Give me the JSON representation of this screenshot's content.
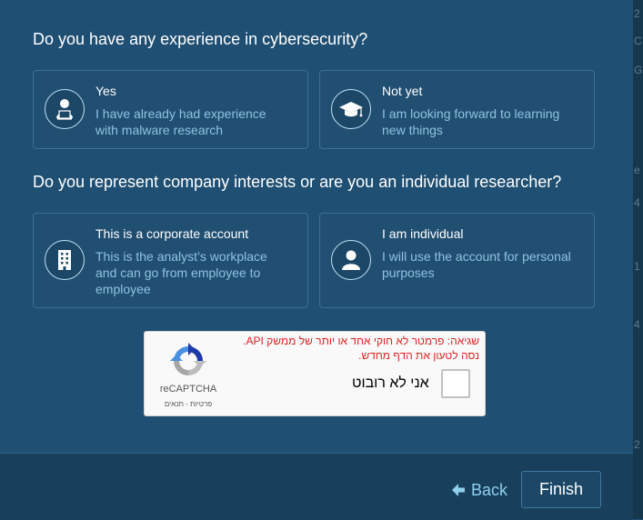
{
  "q1": {
    "question": "Do you have any experience in cybersecurity?",
    "options": [
      {
        "title": "Yes",
        "description": "I have already had experience with malware research",
        "icon": "user-laptop-icon"
      },
      {
        "title": "Not yet",
        "description": "I am looking forward to learning new things",
        "icon": "graduation-cap-icon"
      }
    ]
  },
  "q2": {
    "question": "Do you represent company interests or are you an individual researcher?",
    "options": [
      {
        "title": "This is a corporate account",
        "description": "This is the analyst’s workplace and can go from employee to employee",
        "icon": "building-icon"
      },
      {
        "title": "I am individual",
        "description": "I will use the account for personal purposes",
        "icon": "person-icon"
      }
    ]
  },
  "captcha": {
    "error_line1": "שגיאה: פרמטר לא חוקי אחד או יותר של ממשק API.",
    "error_line2": "נסה לטעון את הדף מחדש.",
    "checkbox_label": "אני לא רובוט",
    "brand": "reCAPTCHA",
    "privacy": "פרטיות",
    "sep": "-",
    "terms": "תנאים"
  },
  "footer": {
    "back_label": "Back",
    "finish_label": "Finish"
  },
  "colors": {
    "background": "#1f4f72",
    "option_border": "#3b7199",
    "description": "#8fc2e0",
    "accent": "#8fd0ee",
    "captcha_error": "#dd2222"
  }
}
